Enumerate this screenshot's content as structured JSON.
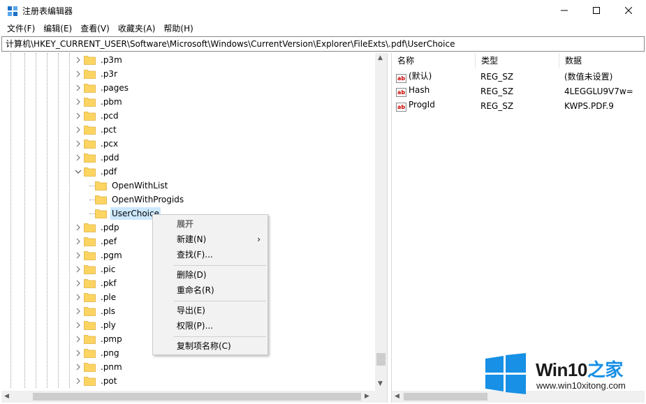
{
  "window": {
    "title": "注册表编辑器",
    "minimize_glyph": "—",
    "maximize_glyph": "☐",
    "close_glyph": "✕"
  },
  "menu": [
    "文件(F)",
    "编辑(E)",
    "查看(V)",
    "收藏夹(A)",
    "帮助(H)"
  ],
  "address": "计算机\\HKEY_CURRENT_USER\\Software\\Microsoft\\Windows\\CurrentVersion\\Explorer\\FileExts\\.pdf\\UserChoice",
  "tree": {
    "items": [
      {
        "label": ".p3m",
        "expanded": false
      },
      {
        "label": ".p3r",
        "expanded": false
      },
      {
        "label": ".pages",
        "expanded": false
      },
      {
        "label": ".pbm",
        "expanded": false
      },
      {
        "label": ".pcd",
        "expanded": false
      },
      {
        "label": ".pct",
        "expanded": false
      },
      {
        "label": ".pcx",
        "expanded": false
      },
      {
        "label": ".pdd",
        "expanded": false
      },
      {
        "label": ".pdf",
        "expanded": true
      },
      {
        "label": "OpenWithList",
        "child": true
      },
      {
        "label": "OpenWithProgids",
        "child": true
      },
      {
        "label": "UserChoice",
        "child": true,
        "selected": true
      },
      {
        "label": ".pdp",
        "expanded": false
      },
      {
        "label": ".pef",
        "expanded": false
      },
      {
        "label": ".pgm",
        "expanded": false
      },
      {
        "label": ".pic",
        "expanded": false
      },
      {
        "label": ".pkf",
        "expanded": false
      },
      {
        "label": ".ple",
        "expanded": false
      },
      {
        "label": ".pls",
        "expanded": false
      },
      {
        "label": ".ply",
        "expanded": false
      },
      {
        "label": ".pmp",
        "expanded": false
      },
      {
        "label": ".png",
        "expanded": false
      },
      {
        "label": ".pnm",
        "expanded": false
      },
      {
        "label": ".pot",
        "expanded": false
      }
    ]
  },
  "list": {
    "columns": [
      "名称",
      "类型",
      "数据"
    ],
    "rows": [
      {
        "name": "(默认)",
        "type": "REG_SZ",
        "data": "(数值未设置)"
      },
      {
        "name": "Hash",
        "type": "REG_SZ",
        "data": "4LEGGLU9V7w="
      },
      {
        "name": "ProgId",
        "type": "REG_SZ",
        "data": "KWPS.PDF.9"
      }
    ],
    "icon_text": "ab"
  },
  "context_menu": {
    "expand": "展开",
    "new": "新建(N)",
    "find": "查找(F)...",
    "delete": "删除(D)",
    "rename": "重命名(R)",
    "export": "导出(E)",
    "permissions": "权限(P)...",
    "copy_key_name": "复制项名称(C)",
    "submenu_arrow": "›"
  },
  "watermark": {
    "brand": "Win10",
    "brand_zh": "之家",
    "url": "www.win10xitong.com"
  },
  "colors": {
    "selection": "#cce8ff",
    "folder": "#fcd462",
    "win_logo": "#1790e5"
  }
}
